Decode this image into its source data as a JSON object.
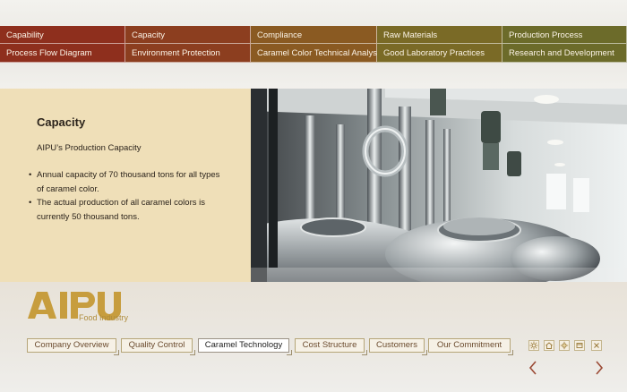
{
  "top_nav": {
    "row1": [
      "Capability",
      "Capacity",
      "Compliance",
      "Raw Materials",
      "Production Process"
    ],
    "row2": [
      "Process Flow Diagram",
      "Environment  Protection",
      "Caramel Color Technical Analysis",
      "Good Laboratory Practices",
      "Research and Development"
    ],
    "colors": [
      "#8e2f1d",
      "#8c3e1f",
      "#8a5a22",
      "#7a6a26",
      "#6c6b2a"
    ]
  },
  "content": {
    "title": "Capacity",
    "subtitle": "AIPU’s Production Capacity",
    "bullets": [
      "Annual capacity of 70 thousand tons for all types of caramel color.",
      "The actual production of all caramel colors is currently 50 thousand tons."
    ],
    "bullet_lines": [
      [
        "Annual capacity of 70 thousand tons for all types",
        "of caramel color."
      ],
      [
        "The actual production of all caramel colors is",
        "currently 50 thousand tons."
      ]
    ],
    "panel_color": "#efdfb8"
  },
  "logo": {
    "brand": "AIPU",
    "tagline": "Food Industry"
  },
  "bottom_tabs": [
    {
      "label": "Company Overview",
      "active": false
    },
    {
      "label": "Quality Control",
      "active": false
    },
    {
      "label": "Caramel Technology",
      "active": true
    },
    {
      "label": "Cost Structure",
      "active": false
    },
    {
      "label": "Customers",
      "active": false
    },
    {
      "label": "Our Commitment",
      "active": false
    }
  ],
  "utility_icons": [
    "sun-icon",
    "home-icon",
    "brightness-icon",
    "window-icon",
    "close-icon"
  ],
  "nav_arrows": [
    "chevron-left-icon",
    "chevron-right-icon"
  ]
}
